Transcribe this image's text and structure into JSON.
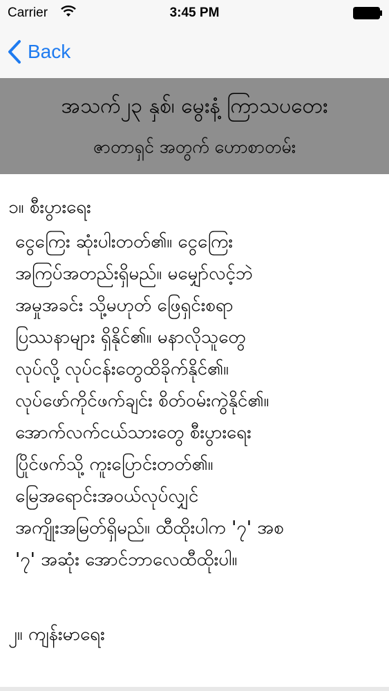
{
  "status_bar": {
    "carrier": "Carrier",
    "time": "3:45 PM"
  },
  "nav": {
    "back_label": "Back"
  },
  "header": {
    "title": "အသက်၂၃ နှစ်၊ မွေးနံ့ ကြာသပတေး",
    "subtitle": "ဇာတာရှင် အတွက် ဟောစာတမ်း"
  },
  "content": {
    "section1_heading": "၁။ စီးပွားရေး",
    "section1_lines": [
      "ငွေကြေး ဆုံးပါးတတ်၏။ ငွေကြေး",
      "အကြပ်အတည်းရှိမည်။ မမျှော်လင့်ဘဲ",
      "အမှုအခင်း သို့မဟုတ် ဖြေရှင်းစရာ",
      "ပြဿနာများ ရှိနိုင်၏။ မနာလိုသူတွေ",
      "လုပ်လို့ လုပ်ငန်းတွေထိခိုက်နိုင်၏။",
      "လုပ်ဖော်ကိုင်ဖက်ချင်း စိတ်ဝမ်းကွဲနိုင်၏။",
      "အောက်လက်ငယ်သားတွေ စီးပွားရေး",
      "ပြိုင်ဖက်သို့ ကူးပြောင်းတတ်၏။",
      "မြေအရောင်းအဝယ်လုပ်လျှင်",
      "အကျိုးအမြတ်ရှိမည်။ ထီထိုးပါက '၇' အစ",
      "'၇' အဆုံး အောင်ဘာလေထီထိုးပါ။"
    ],
    "section2_heading": "၂။ ကျန်းမာရေး"
  },
  "colors": {
    "accent": "#1e7bf0",
    "header_band": "#8e8e8e",
    "bars": "#f7f7f7"
  }
}
